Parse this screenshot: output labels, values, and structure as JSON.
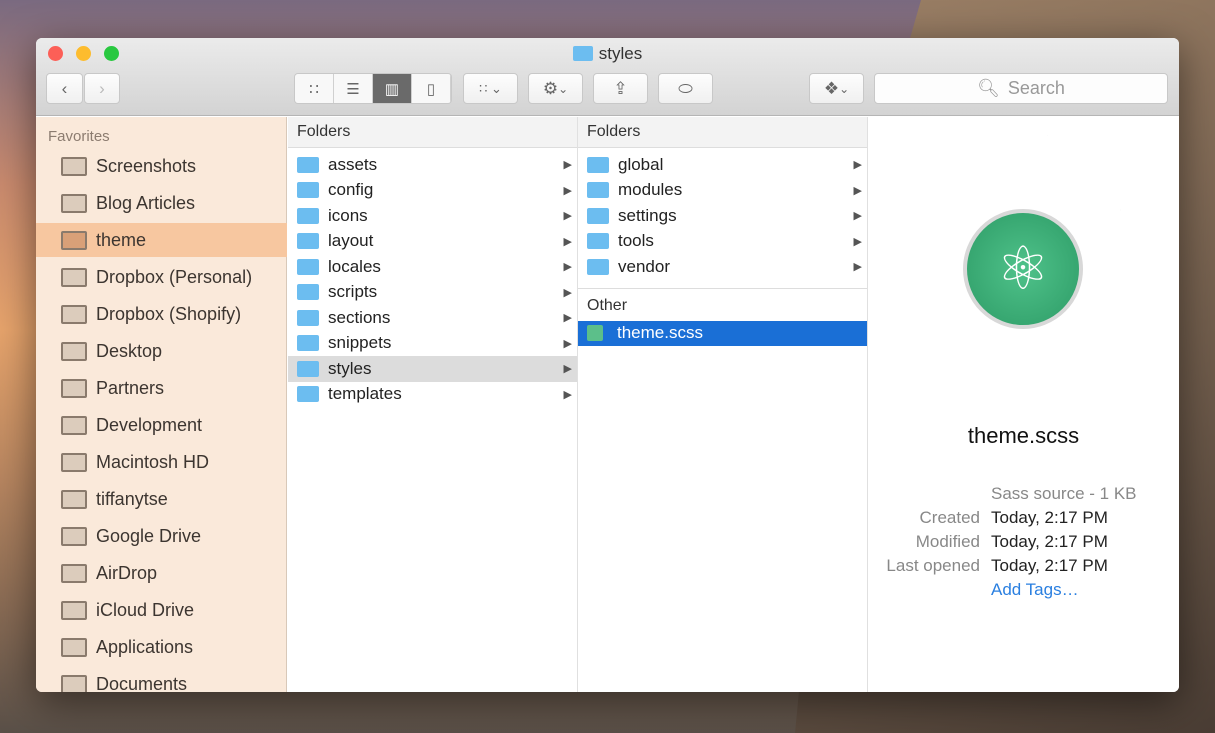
{
  "window": {
    "title": "styles"
  },
  "toolbar": {
    "search_placeholder": "Search"
  },
  "sidebar": {
    "heading": "Favorites",
    "items": [
      "Screenshots",
      "Blog Articles",
      "theme",
      "Dropbox (Personal)",
      "Dropbox (Shopify)",
      "Desktop",
      "Partners",
      "Development",
      "Macintosh HD",
      "tiffanytse",
      "Google Drive",
      "AirDrop",
      "iCloud Drive",
      "Applications",
      "Documents"
    ],
    "selected": "theme"
  },
  "column1": {
    "header": "Folders",
    "items": [
      "assets",
      "config",
      "icons",
      "layout",
      "locales",
      "scripts",
      "sections",
      "snippets",
      "styles",
      "templates"
    ],
    "selected": "styles"
  },
  "column2": {
    "header": "Folders",
    "items": [
      "global",
      "modules",
      "settings",
      "tools",
      "vendor"
    ],
    "other_header": "Other",
    "file": "theme.scss"
  },
  "preview": {
    "name": "theme.scss",
    "kind": "Sass source - 1 KB",
    "created_label": "Created",
    "created": "Today, 2:17 PM",
    "modified_label": "Modified",
    "modified": "Today, 2:17 PM",
    "opened_label": "Last opened",
    "opened": "Today, 2:17 PM",
    "add_tags": "Add Tags…"
  }
}
